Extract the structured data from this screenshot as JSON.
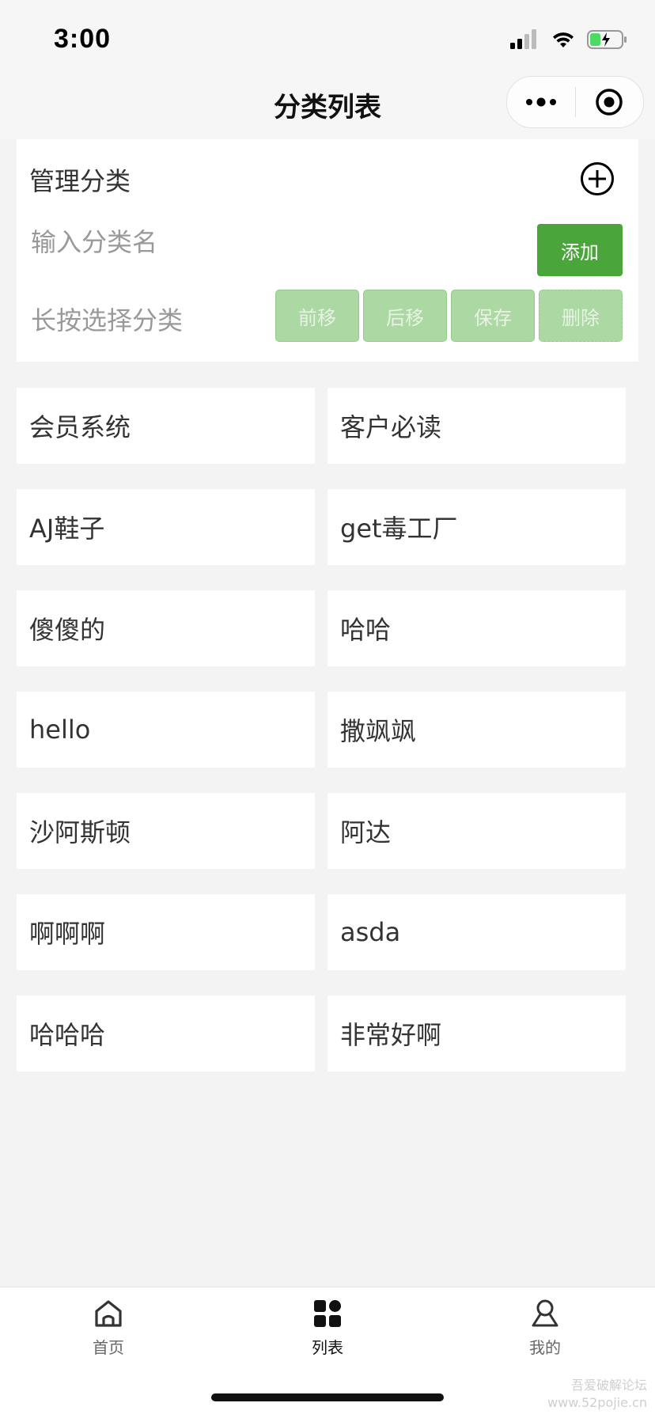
{
  "status": {
    "time": "3:00"
  },
  "nav": {
    "title": "分类列表"
  },
  "manage": {
    "title": "管理分类",
    "input_placeholder": "输入分类名",
    "add_label": "添加",
    "hint": "长按选择分类",
    "ops": [
      "前移",
      "后移",
      "保存",
      "删除"
    ]
  },
  "categories": [
    "会员系统",
    "客户必读",
    "AJ鞋子",
    "get毒工厂",
    "傻傻的",
    "哈哈",
    "hello",
    "撒飒飒",
    "沙阿斯顿",
    "阿达",
    "啊啊啊",
    "asda",
    "哈哈哈",
    "非常好啊"
  ],
  "tabs": [
    {
      "label": "首页",
      "icon": "home-icon"
    },
    {
      "label": "列表",
      "icon": "grid-icon"
    },
    {
      "label": "我的",
      "icon": "user-icon"
    }
  ],
  "watermark": {
    "line1": "吾爱破解论坛",
    "line2": "www.52pojie.cn"
  },
  "colors": {
    "accent": "#4aa53a",
    "disabled_button": "#acd8a3",
    "background": "#f3f3f3"
  }
}
